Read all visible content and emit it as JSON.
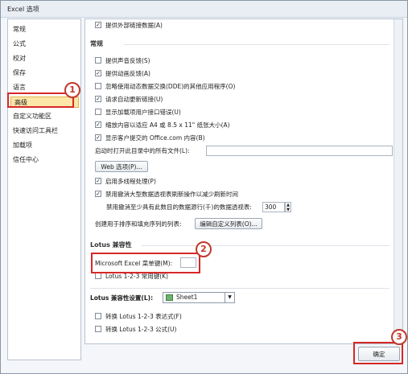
{
  "window_title": "Excel 选项",
  "sidebar": {
    "items": [
      {
        "label": "常规"
      },
      {
        "label": "公式"
      },
      {
        "label": "校对"
      },
      {
        "label": "保存"
      },
      {
        "label": "语言"
      },
      {
        "label": "高级"
      },
      {
        "label": "自定义功能区"
      },
      {
        "label": "快速访问工具栏"
      },
      {
        "label": "加载项"
      },
      {
        "label": "信任中心"
      }
    ]
  },
  "main": {
    "top_partial": "提供外部链接数据(A)",
    "general_header": "常规",
    "options": [
      {
        "label": "提供声音反馈(S)",
        "checked": false
      },
      {
        "label": "提供动画反馈(A)",
        "checked": true
      },
      {
        "label": "忽略使用动态数据交换(DDE)的其他应用程序(O)",
        "checked": false
      },
      {
        "label": "请求自动更新链接(U)",
        "checked": true
      },
      {
        "label": "显示加载项用户接口错误(U)",
        "checked": false
      },
      {
        "label": "缩放内容以适应 A4 或 8.5 x 11\" 纸张大小(A)",
        "checked": true
      },
      {
        "label": "显示客户提交的 Office.com 内容(B)",
        "checked": true
      }
    ],
    "startup_label": "启动时打开此目录中的所有文件(L):",
    "startup_value": "",
    "web_options_button": "Web 选项(P)...",
    "multithread_label": "启用多线程处理(P)",
    "multithread_checked": true,
    "pivot_label": "禁用撤消大型数据透视表刷新操作以减少刷新时间",
    "pivot_checked": true,
    "pivot_rows_label": "禁用撤消至少具有此数目的数据源行(千)的数据透视表:",
    "pivot_rows_value": "300",
    "custom_list_label": "创建用于排序和填充序列的列表:",
    "custom_list_button": "编辑自定义列表(O)...",
    "lotus_compat_header": "Lotus 兼容性",
    "menu_key_label": "Microsoft Excel 菜单键(M):",
    "menu_key_value": "",
    "lotus_nav_label": "Lotus 1-2-3 常用键(K)",
    "lotus_nav_checked": false,
    "lotus_settings_label": "Lotus 兼容性设置(L):",
    "lotus_sheet_value": "Sheet1",
    "lotus_expr_label": "转换 Lotus 1-2-3 表达式(F)",
    "lotus_formula_label": "转换 Lotus 1-2-3 公式(U)",
    "lotus_expr_checked": false,
    "lotus_formula_checked": false
  },
  "footer": {
    "ok_button": "确定"
  },
  "callouts": [
    "1",
    "2",
    "3"
  ]
}
